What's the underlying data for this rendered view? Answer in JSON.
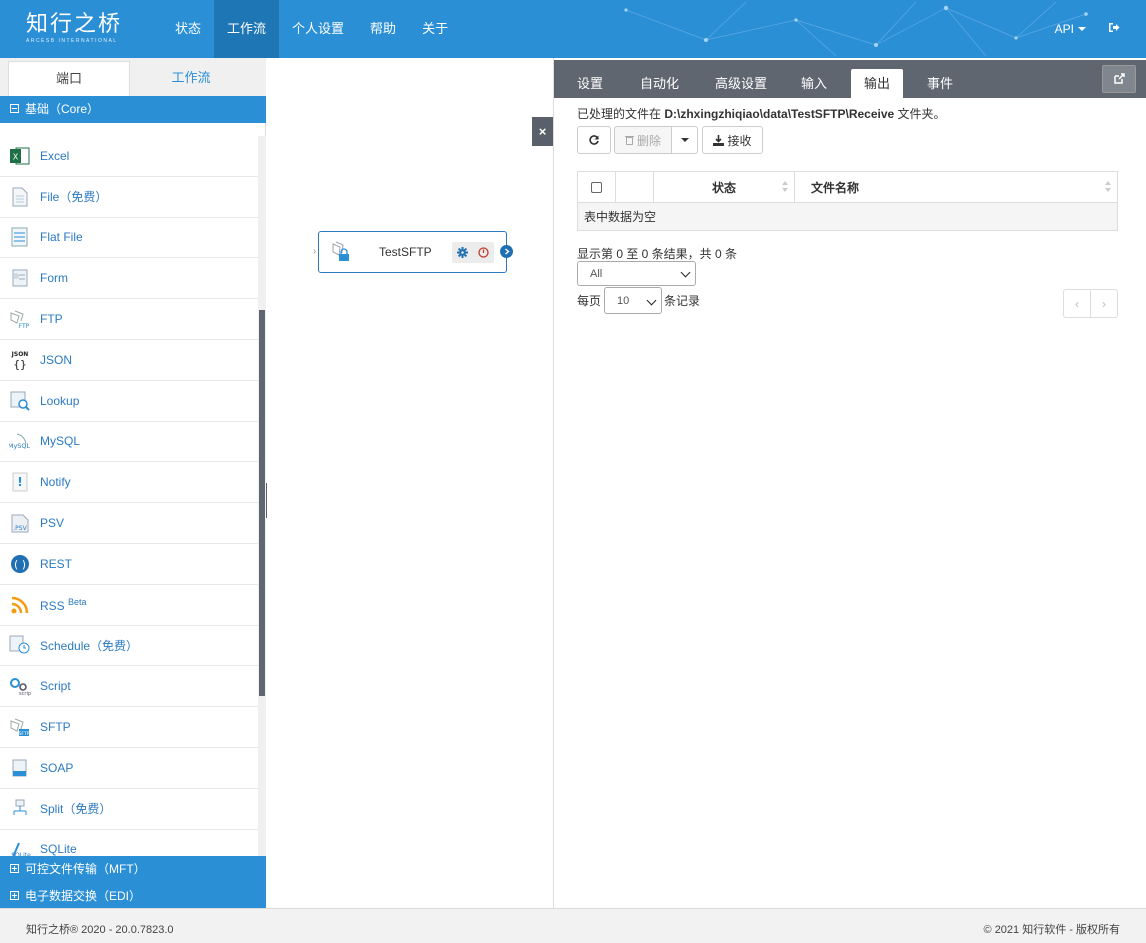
{
  "app": {
    "logo_text": "知行之桥",
    "logo_sub": "ARCESB INTERNATIONAL"
  },
  "nav": {
    "items": [
      "状态",
      "工作流",
      "个人设置",
      "帮助",
      "关于"
    ],
    "active": "工作流",
    "api_label": "API"
  },
  "left_panel": {
    "tabs": [
      "端口",
      "工作流"
    ],
    "active_tab": "端口",
    "categories": {
      "core": "基础（Core）",
      "mft": "可控文件传输（MFT）",
      "edi": "电子数据交换（EDI）"
    },
    "components": [
      {
        "label": "Excel",
        "icon": "excel-icon"
      },
      {
        "label": "File（免费）",
        "icon": "file-icon"
      },
      {
        "label": "Flat File",
        "icon": "flat-file-icon"
      },
      {
        "label": "Form",
        "icon": "form-icon"
      },
      {
        "label": "FTP",
        "icon": "ftp-icon"
      },
      {
        "label": "JSON",
        "icon": "json-icon"
      },
      {
        "label": "Lookup",
        "icon": "lookup-icon"
      },
      {
        "label": "MySQL",
        "icon": "mysql-icon"
      },
      {
        "label": "Notify",
        "icon": "notify-icon"
      },
      {
        "label": "PSV",
        "icon": "psv-icon"
      },
      {
        "label": "REST",
        "icon": "rest-icon"
      },
      {
        "label": "RSS",
        "badge": "Beta",
        "icon": "rss-icon"
      },
      {
        "label": "Schedule（免费）",
        "icon": "schedule-icon"
      },
      {
        "label": "Script",
        "icon": "script-icon"
      },
      {
        "label": "SFTP",
        "icon": "sftp-icon"
      },
      {
        "label": "SOAP",
        "icon": "soap-icon"
      },
      {
        "label": "Split（免费）",
        "icon": "split-icon"
      },
      {
        "label": "SQLite",
        "icon": "sqlite-icon"
      }
    ]
  },
  "canvas": {
    "node": {
      "title": "TestSFTP"
    }
  },
  "right_panel": {
    "tabs": [
      "设置",
      "自动化",
      "高级设置",
      "输入",
      "输出",
      "事件"
    ],
    "active_tab": "输出",
    "info_prefix": "已处理的文件在",
    "info_path": "D:\\zhxingzhiqiao\\data\\TestSFTP\\Receive",
    "info_suffix": "文件夹。",
    "buttons": {
      "delete": "删除",
      "receive": "接收"
    },
    "table": {
      "columns": [
        "状态",
        "文件名称"
      ],
      "empty_text": "表中数据为空"
    },
    "summary": "显示第 0 至 0 条结果，共 0 条",
    "filter_select": "All",
    "per_page_prefix": "每页",
    "per_page_value": "10",
    "per_page_suffix": "条记录",
    "pager": {
      "prev": "‹",
      "next": "›"
    }
  },
  "footer": {
    "left": "知行之桥® 2020 - 20.0.7823.0",
    "right": "© 2021 知行软件 - 版权所有"
  },
  "colors": {
    "brand_blue": "#2b8fd6",
    "nav_active": "#1f76b5",
    "tab_bar": "#5f6670",
    "link": "#2b7ac0"
  }
}
